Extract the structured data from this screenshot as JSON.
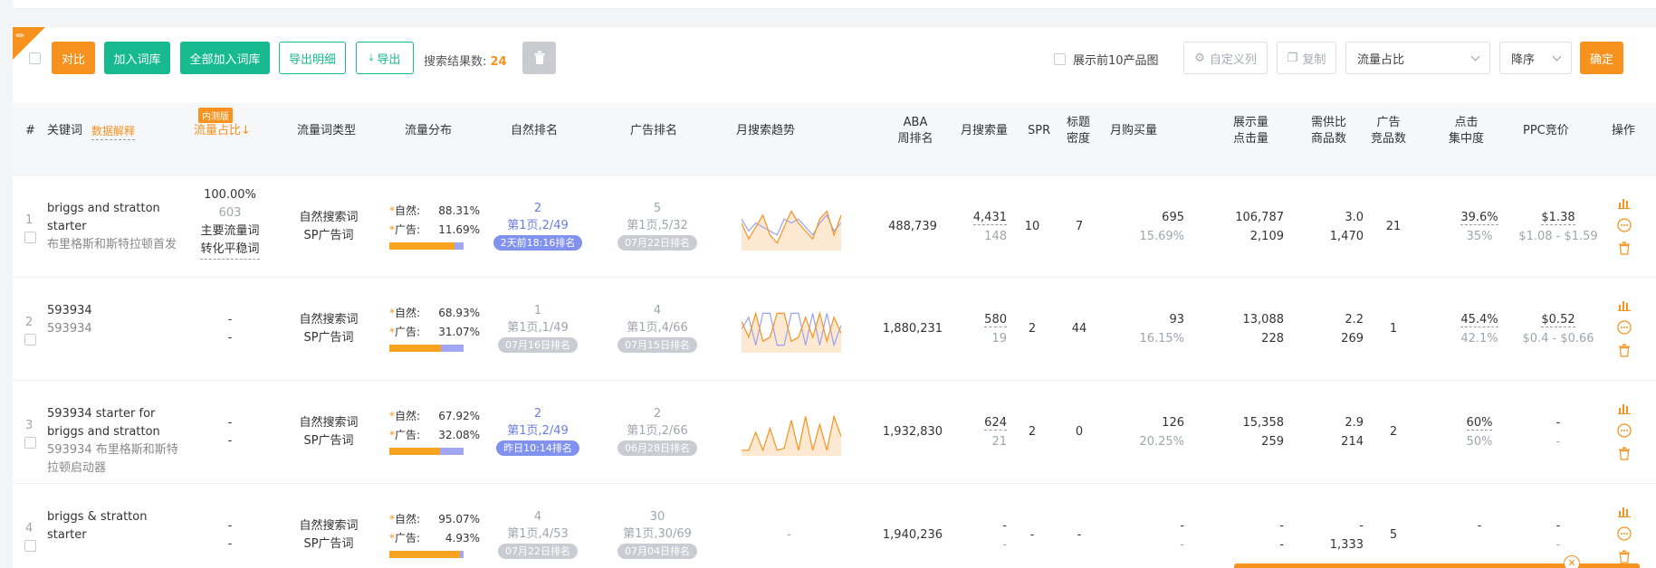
{
  "toolbar": {
    "compare": "对比",
    "add_to_lexicon": "加入词库",
    "add_all_to_lexicon": "全部加入词库",
    "export_detail": "导出明细",
    "export": "导出",
    "result_label": "搜索结果数:",
    "result_count": "24",
    "top10_label": "展示前10产品图",
    "custom_columns": "自定义列",
    "copy": "复制",
    "sort_field": "流量占比",
    "sort_order": "降序",
    "confirm": "确定"
  },
  "headers": {
    "index": "#",
    "keyword": "关键词",
    "data_explain": "数据解释",
    "beta_badge": "内测版",
    "traffic_share": "流量占比↓",
    "traffic_type": "流量词类型",
    "traffic_dist": "流量分布",
    "organic_rank": "自然排名",
    "ad_rank": "广告排名",
    "monthly_trend": "月搜索趋势",
    "aba_line1": "ABA",
    "aba_line2": "周排名",
    "monthly_search": "月搜索量",
    "spr": "SPR",
    "title_density_1": "标题",
    "title_density_2": "密度",
    "monthly_purchase": "月购买量",
    "impr_click_1": "展示量",
    "impr_click_2": "点击量",
    "supply_demand_1": "需供比",
    "supply_demand_2": "商品数",
    "ad_products_1": "广告",
    "ad_products_2": "竞品数",
    "click_conc_1": "点击",
    "click_conc_2": "集中度",
    "ppc": "PPC竞价",
    "ops": "操作"
  },
  "labels": {
    "organic_word": "自然搜索词",
    "sp_word": "SP广告词",
    "organic_prefix": "自然:",
    "ad_prefix": "广告:"
  },
  "rows": [
    {
      "index": "1",
      "keyword": "briggs and stratton starter",
      "keyword_cn": "布里格斯和斯特拉顿首发",
      "share_pct": "100.00%",
      "share_count": "603",
      "share_tag1": "主要流量词",
      "share_tag2": "转化平稳词",
      "organic_pct": "88.31%",
      "organic_frac": 0.8831,
      "ad_pct": "11.69%",
      "organic_rank_num": "2",
      "organic_rank_text": "第1页,2/49",
      "organic_rank_badge": "2天前18:16排名",
      "organic_badge_blue": true,
      "ad_rank_num": "5",
      "ad_rank_text": "第1页,5/32",
      "ad_rank_badge": "07月22日排名",
      "trend": [
        0.6,
        0.2,
        0.5,
        0.8,
        0.3,
        0.1,
        0.5,
        0.9,
        0.6,
        0.4,
        0.2,
        0.7,
        0.9,
        0.3,
        0.8
      ],
      "trend2": [
        0.7,
        0.4,
        0.6,
        0.5,
        0.4,
        0.3,
        0.7,
        0.6,
        0.7,
        0.5,
        0.3,
        0.6,
        0.8,
        0.4,
        0.6
      ],
      "aba": "488,739",
      "monthly_search": "4,431",
      "monthly_search_sub": "148",
      "spr": "10",
      "title_density": "7",
      "purchase": "695",
      "purchase_rate": "15.69%",
      "impressions": "106,787",
      "clicks": "2,109",
      "supply_ratio": "3.0",
      "product_count": "1,470",
      "ad_products": "21",
      "click_conc": "39.6%",
      "click_conc_sub": "35%",
      "ppc": "$1.38",
      "ppc_range": "$1.08 - $1.59"
    },
    {
      "index": "2",
      "keyword": "593934",
      "keyword_cn": "593934",
      "share_pct": "-",
      "share_count": "-",
      "share_tag1": "",
      "share_tag2": "",
      "organic_pct": "68.93%",
      "organic_frac": 0.6893,
      "ad_pct": "31.07%",
      "organic_rank_num": "1",
      "organic_rank_text": "第1页,1/49",
      "organic_rank_badge": "07月16日排名",
      "organic_badge_blue": false,
      "ad_rank_num": "4",
      "ad_rank_text": "第1页,4/66",
      "ad_rank_badge": "07月15日排名",
      "trend": [
        0.7,
        0.3,
        0.9,
        0.2,
        0.3,
        0.9,
        0.9,
        0.2,
        0.3,
        0.8,
        0.3,
        0.9,
        0.2,
        0.8,
        0.4
      ],
      "trend2": [
        0.5,
        0.8,
        0.1,
        0.9,
        0.9,
        0.1,
        0.1,
        0.9,
        0.9,
        0.1,
        0.9,
        0.1,
        0.9,
        0.1,
        0.6
      ],
      "aba": "1,880,231",
      "monthly_search": "580",
      "monthly_search_sub": "19",
      "spr": "2",
      "title_density": "44",
      "purchase": "93",
      "purchase_rate": "16.15%",
      "impressions": "13,088",
      "clicks": "228",
      "supply_ratio": "2.2",
      "product_count": "269",
      "ad_products": "1",
      "click_conc": "45.4%",
      "click_conc_sub": "42.1%",
      "ppc": "$0.52",
      "ppc_range": "$0.4 - $0.66"
    },
    {
      "index": "3",
      "keyword": "593934 starter for briggs and stratton",
      "keyword_cn": "593934 布里格斯和斯特拉顿启动器",
      "share_pct": "-",
      "share_count": "-",
      "share_tag1": "",
      "share_tag2": "",
      "organic_pct": "67.92%",
      "organic_frac": 0.6792,
      "ad_pct": "32.08%",
      "organic_rank_num": "2",
      "organic_rank_text": "第1页,2/49",
      "organic_rank_badge": "昨日10:14排名",
      "organic_badge_blue": true,
      "ad_rank_num": "2",
      "ad_rank_text": "第1页,2/66",
      "ad_rank_badge": "06月28日排名",
      "trend": [
        0.05,
        0.05,
        0.5,
        0.05,
        0.6,
        0.05,
        0.1,
        0.8,
        0.05,
        0.9,
        0.05,
        0.7,
        0.05,
        0.9,
        0.4
      ],
      "trend2": [],
      "aba": "1,932,830",
      "monthly_search": "624",
      "monthly_search_sub": "21",
      "spr": "2",
      "title_density": "0",
      "purchase": "126",
      "purchase_rate": "20.25%",
      "impressions": "15,358",
      "clicks": "259",
      "supply_ratio": "2.9",
      "product_count": "214",
      "ad_products": "2",
      "click_conc": "60%",
      "click_conc_sub": "50%",
      "ppc": "-",
      "ppc_range": "-"
    },
    {
      "index": "4",
      "keyword": "briggs & stratton starter",
      "keyword_cn": "",
      "share_pct": "-",
      "share_count": "-",
      "share_tag1": "",
      "share_tag2": "",
      "organic_pct": "95.07%",
      "organic_frac": 0.9507,
      "ad_pct": "4.93%",
      "organic_rank_num": "4",
      "organic_rank_text": "第1页,4/53",
      "organic_rank_badge": "07月22日排名",
      "organic_badge_blue": false,
      "ad_rank_num": "30",
      "ad_rank_text": "第1页,30/69",
      "ad_rank_badge": "07月04日排名",
      "trend_text": "-",
      "trend": [],
      "trend2": [],
      "aba": "1,940,236",
      "monthly_search": "-",
      "monthly_search_sub": "-",
      "spr": "-",
      "title_density": "-",
      "purchase": "-",
      "purchase_rate": "-",
      "impressions": "-",
      "clicks": "-",
      "supply_ratio": "-",
      "product_count": "1,333",
      "ad_products": "5",
      "click_conc": "-",
      "click_conc_sub": "",
      "ppc": "-",
      "ppc_range": "-"
    }
  ],
  "colors": {
    "accent_orange": "#f7921e",
    "accent_green": "#17b98f",
    "bar_organic": "#f8a320",
    "bar_ad": "#a3a5f5",
    "rank_blue": "#6b7ce6"
  }
}
